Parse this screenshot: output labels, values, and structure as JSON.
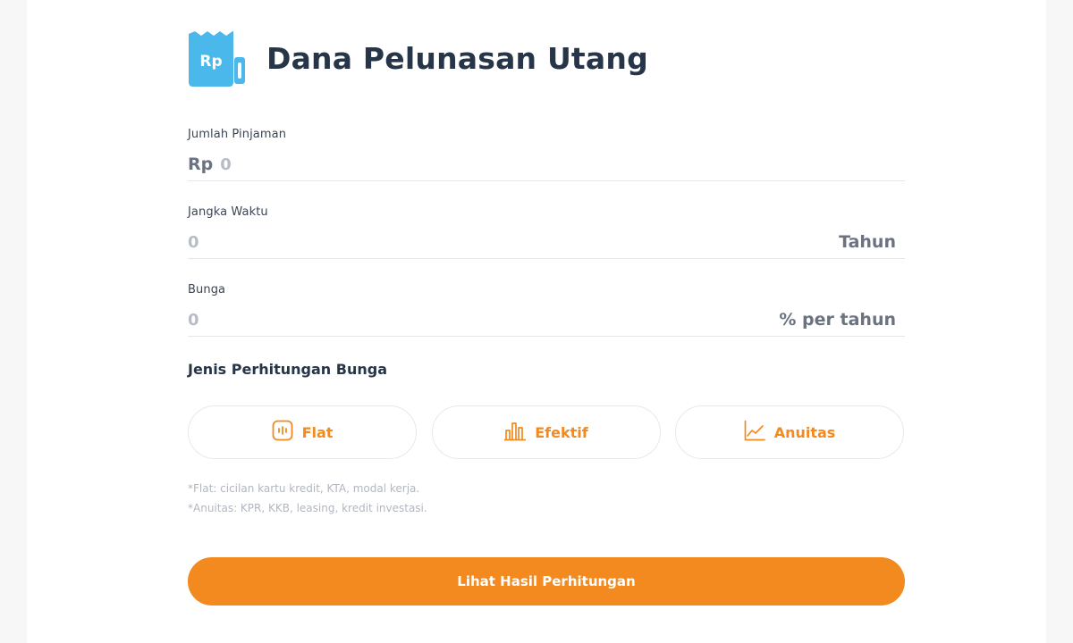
{
  "header": {
    "title": "Dana Pelunasan Utang",
    "logo_text": "Rp",
    "logo_color": "#4bb8ec"
  },
  "fields": {
    "loan": {
      "label": "Jumlah Pinjaman",
      "prefix": "Rp",
      "placeholder": "0"
    },
    "term": {
      "label": "Jangka Waktu",
      "placeholder": "0",
      "suffix": "Tahun"
    },
    "interest": {
      "label": "Bunga",
      "placeholder": "0",
      "suffix": "% per tahun"
    }
  },
  "interest_type": {
    "title": "Jenis Perhitungan Bunga",
    "options": [
      {
        "label": "Flat",
        "icon": "flat-icon"
      },
      {
        "label": "Efektif",
        "icon": "efektif-icon"
      },
      {
        "label": "Anuitas",
        "icon": "anuitas-icon"
      }
    ]
  },
  "notes": [
    "*Flat: cicilan kartu kredit, KTA, modal kerja.",
    "*Anuitas: KPR, KKB, leasing, kredit investasi."
  ],
  "cta": {
    "label": "Lihat Hasil Perhitungan"
  },
  "colors": {
    "accent": "#f28a1f",
    "logo": "#4bb8ec",
    "text": "#263548"
  }
}
